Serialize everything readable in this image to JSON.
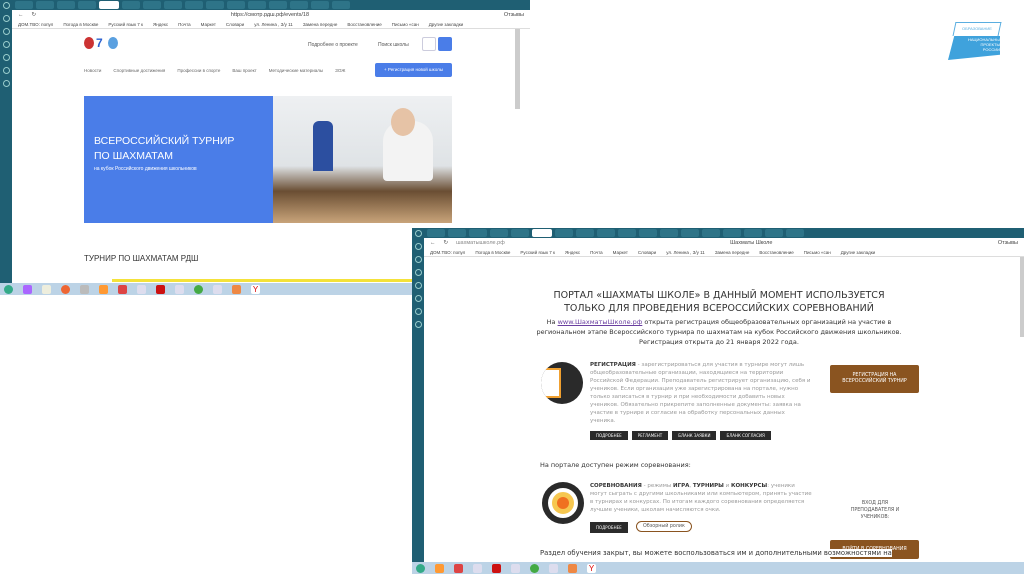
{
  "left_browser": {
    "url": "https://смотр.рдш.рф/events/18",
    "feedback": "Отзывы",
    "bookmarks": [
      "ДОМ.ТВО: попул",
      "Погода в Москве",
      "Русский язык 7 к",
      "Яндекс",
      "Почта",
      "Маркет",
      "Словари",
      "ул. Ленина , З/у 11",
      "Замена передне",
      "Восстановление",
      "Письмо «сан",
      "Другие закладки"
    ],
    "header": {
      "about": "Подробнее о проекте",
      "search": "Поиск школы"
    },
    "nav": [
      "Новости",
      "Спортивные достижения",
      "Профессии в спорте",
      "Ваш проект",
      "Методические материалы",
      "ЗОЖ"
    ],
    "register_button": "+ Регистрация новой школы",
    "hero": {
      "title_line1": "ВСЕРОССИЙСКИЙ ТУРНИР",
      "title_line2": "ПО ШАХМАТАМ",
      "subtitle": "на кубок Российского движения школьников"
    },
    "section_title": "ТУРНИР ПО ШАХМАТАМ РДШ"
  },
  "logo": {
    "top": "ОБРАЗОВАНИЕ",
    "main": "НАЦИОНАЛЬНЫЕ ПРОЕКТЫ РОССИИ"
  },
  "right_browser": {
    "url": "шахматышколе.рф",
    "title": "Шахматы Школе",
    "feedback": "Отзывы",
    "heading": "ПОРТАЛ «ШАХМАТЫ ШКОЛЕ» В ДАННЫЙ МОМЕНТ ИСПОЛЬЗУЕТСЯ ТОЛЬКО ДЛЯ ПРОВЕДЕНИЯ ВСЕРОССИЙСКИХ СОРЕВНОВАНИЙ",
    "intro_prefix": "На ",
    "intro_link": "www.ШахматыШколе.рф",
    "intro_rest": " открыта регистрация общеобразовательных организаций на участие в региональном этапе Всероссийского турнира по шахматам на кубок Российского движения школьников. Регистрация открыта до 21 января 2022 года.",
    "registration": {
      "label": "РЕГИСТРАЦИЯ",
      "text": " - зарегистрироваться для участия в турнире могут лишь общеобразовательные организации, находящиеся на территории Российской Федерации. Преподаватель регистрирует организацию, себя и учеников. Если организация уже зарегистрирована на портале, нужно только записаться в турнир и при необходимости добавить новых учеников. Обязательно прикрепите заполненные документы: заявка на участие в турнире и согласие на обработку персональных данных ученика.",
      "buttons": [
        "ПОДРОБНЕЕ",
        "РЕГЛАМЕНТ",
        "БЛАНК ЗАЯВКИ",
        "БЛАНК СОГЛАСИЯ"
      ],
      "cta": "РЕГИСТРАЦИЯ НА ВСЕРОССИЙСКИЙ ТУРНИР"
    },
    "mode_text": "На портале доступен режим соревнования:",
    "competitions": {
      "label": "СОРЕВНОВАНИЯ",
      "t1": " - режимы ",
      "b1": "ИГРА",
      "b2": "ТУРНИРЫ",
      "t2": " и ",
      "b3": "КОНКУРСЫ",
      "text": ": ученики могут сыграть с другими школьниками или компьютером, принять участие в турнирах и конкурсах. По итогам каждого соревнования определяется лучшие ученики, школам начисляются очки.",
      "more": "ПОДРОБНЕЕ",
      "video": "Обзорный ролик",
      "login_caption": "ВХОД ДЛЯ ПРЕПОДАВАТЕЛЯ И УЧЕНИКОВ:",
      "cta": "ВОЙТИ В СОРЕВНОВАНИЯ"
    },
    "bottom_text": "Раздел обучения закрыт, вы можете воспользоваться им и дополнительными возможностями на"
  },
  "colors": {
    "chrome": "#1f5f73",
    "blue": "#4a7de8",
    "brown": "#8a5420",
    "dark": "#2b2b2b"
  }
}
